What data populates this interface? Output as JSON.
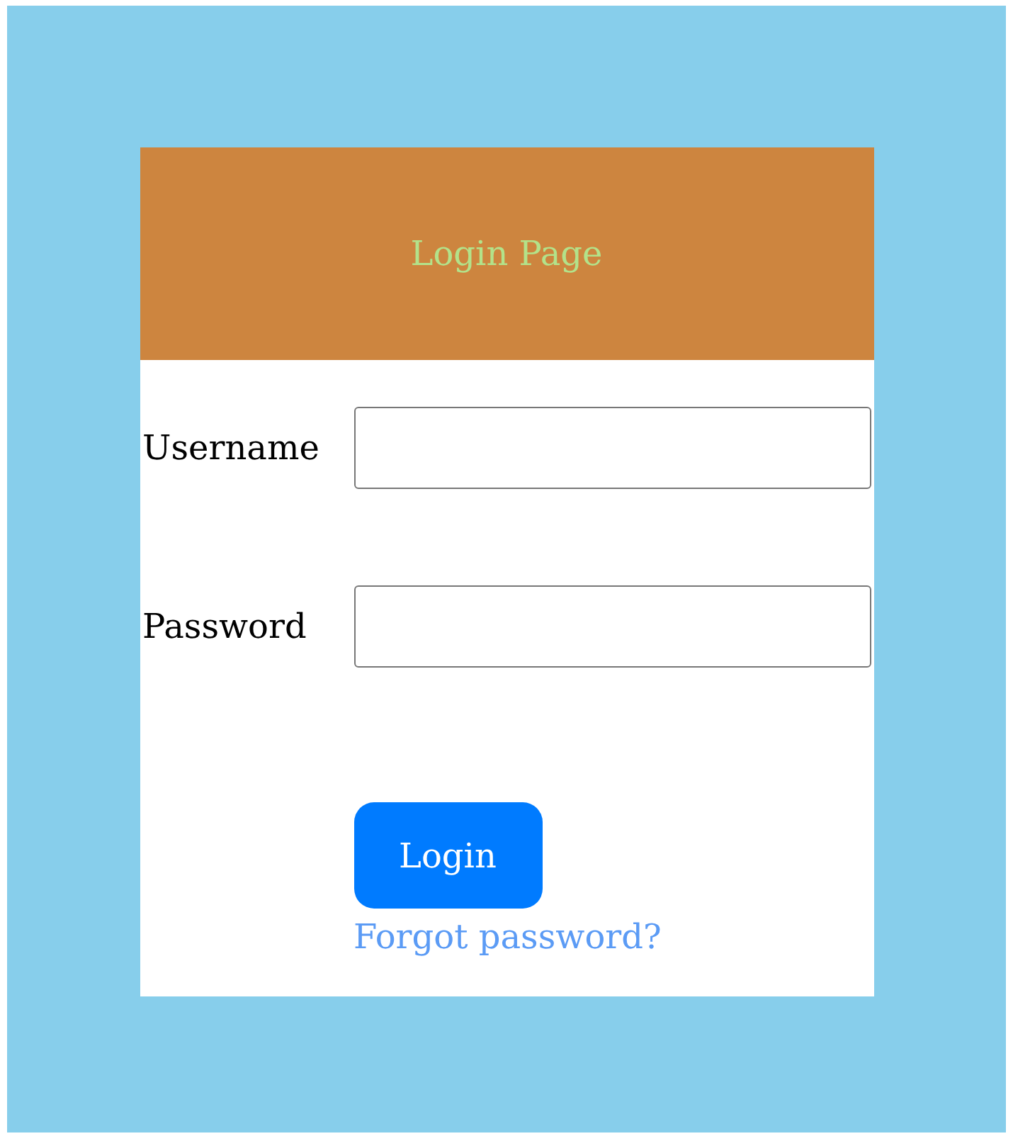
{
  "header": {
    "title": "Login Page"
  },
  "fields": [
    {
      "label": "Username"
    },
    {
      "label": "Password"
    }
  ],
  "button": {
    "label": "Login"
  },
  "link": {
    "label": "Forgot password?"
  }
}
